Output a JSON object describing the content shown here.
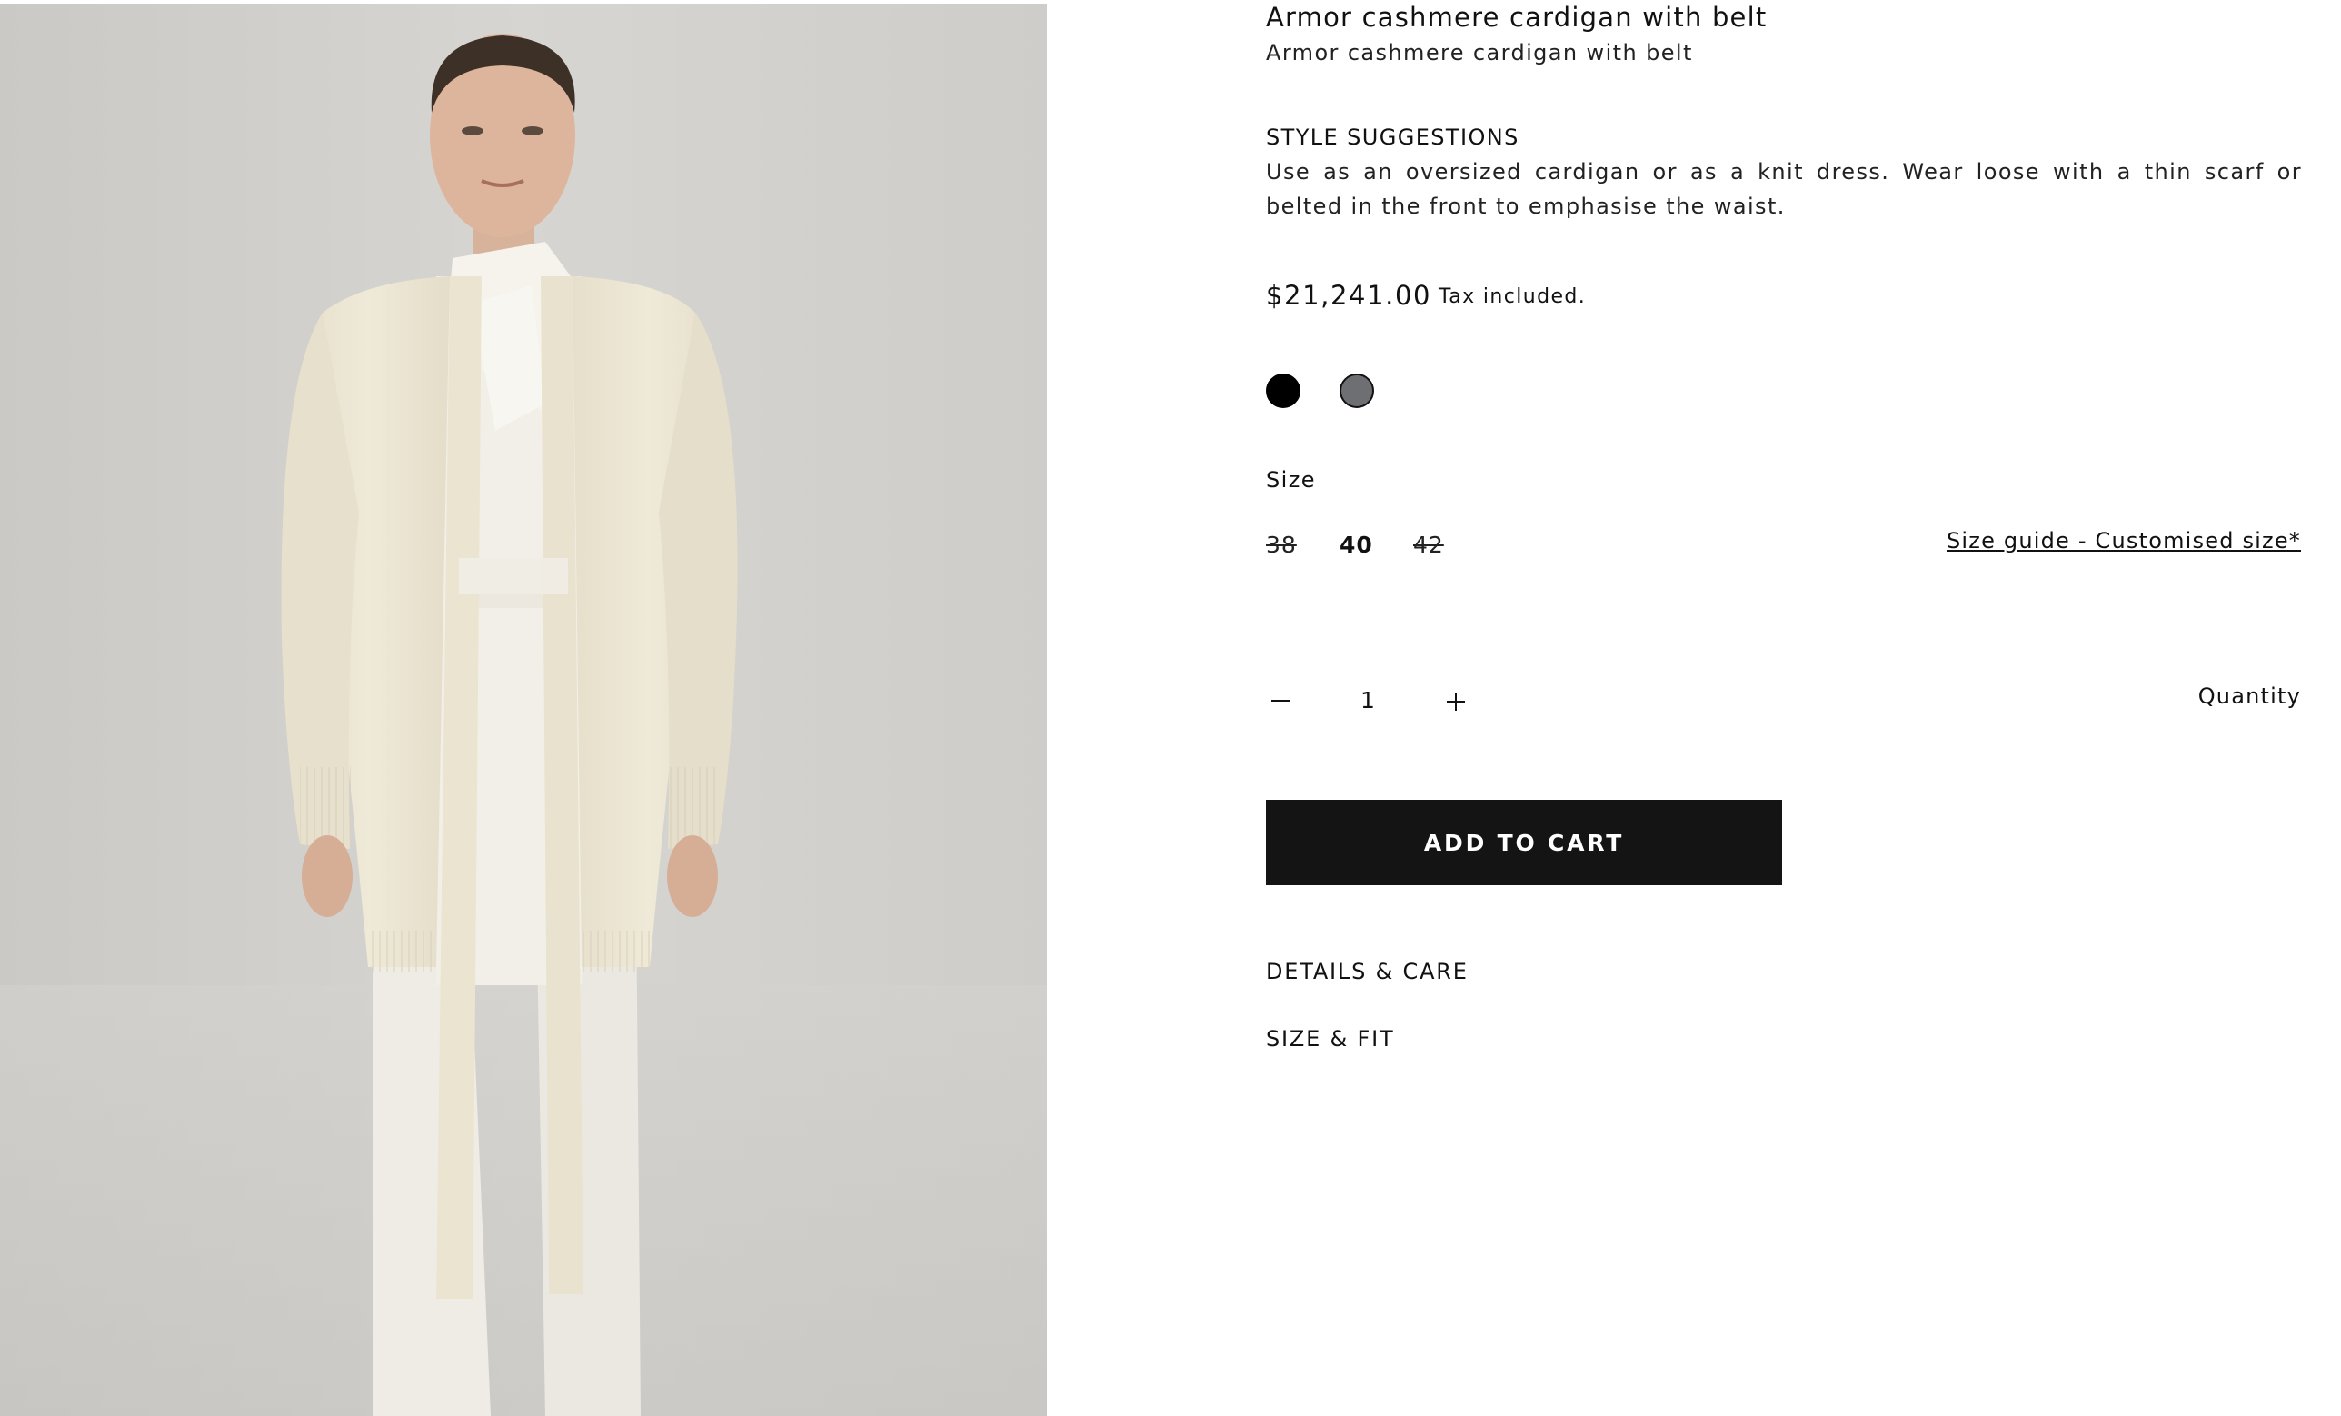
{
  "product": {
    "title": "Armor cashmere cardigan with belt",
    "subtitle": "Armor cashmere cardigan with belt",
    "image_alt": "Model wearing ivory cashmere cardigan with belt"
  },
  "style_suggestions": {
    "heading": "STYLE SUGGESTIONS",
    "text": "Use as an oversized cardigan or as a knit dress. Wear loose with a thin scarf or belted in the front to emphasise the waist."
  },
  "pricing": {
    "price": "$21,241.00",
    "tax_note": "Tax included."
  },
  "colors": {
    "swatches": [
      {
        "name": "black",
        "hex": "#000000",
        "selected": true
      },
      {
        "name": "grey",
        "hex": "#6d6f72",
        "selected": false
      }
    ]
  },
  "size": {
    "label": "Size",
    "options": [
      {
        "label": "38",
        "available": false
      },
      {
        "label": "40",
        "available": true,
        "selected": true
      },
      {
        "label": "42",
        "available": false
      }
    ],
    "guide_link": "Size guide - Customised size*"
  },
  "quantity": {
    "label": "Quantity",
    "value": "1",
    "minus_icon": "minus-icon",
    "plus_icon": "plus-icon"
  },
  "cart": {
    "add_label": "ADD TO CART",
    "button_color": "#141414"
  },
  "accordions": {
    "details_label": "DETAILS & CARE",
    "fit_label": "SIZE & FIT"
  }
}
